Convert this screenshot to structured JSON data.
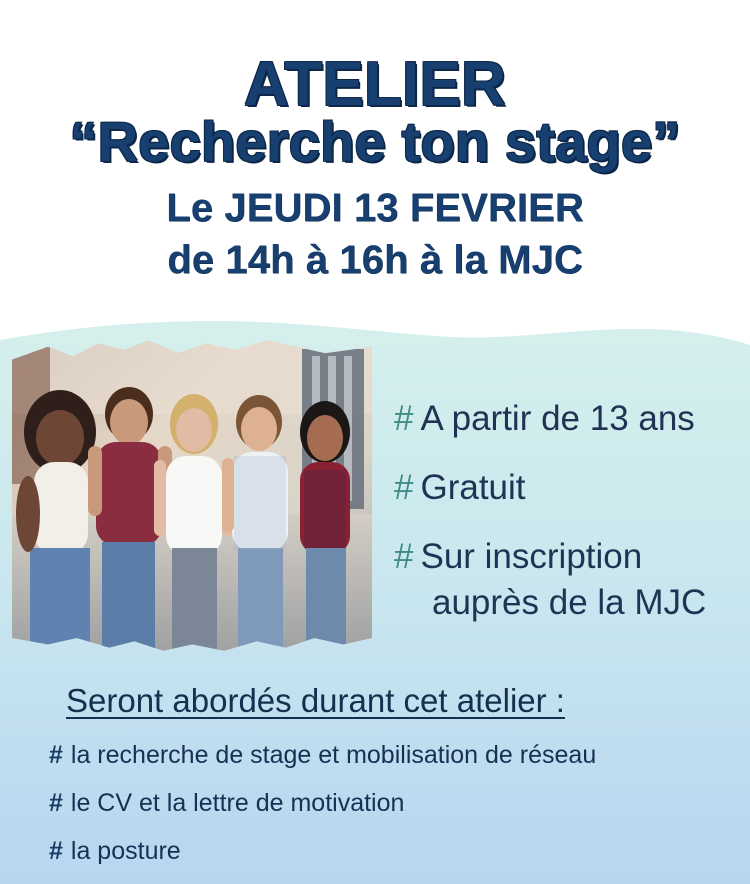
{
  "poster": {
    "title_line1": "ATELIER",
    "title_line2": "“Recherche ton stage”",
    "date_line1": "Le JEUDI 13 FEVRIER",
    "date_line2": "de 14h à 16h à la MJC"
  },
  "info": {
    "marker": "#",
    "items": [
      "A partir de 13 ans",
      "Gratuit",
      "Sur inscription",
      "auprès de la MJC"
    ]
  },
  "section": {
    "title": "Seront abordés durant cet atelier :"
  },
  "topics": {
    "marker": "#",
    "items": [
      "la recherche de stage et mobilisation de réseau",
      "le CV et la lettre de motivation",
      "la posture"
    ]
  }
}
